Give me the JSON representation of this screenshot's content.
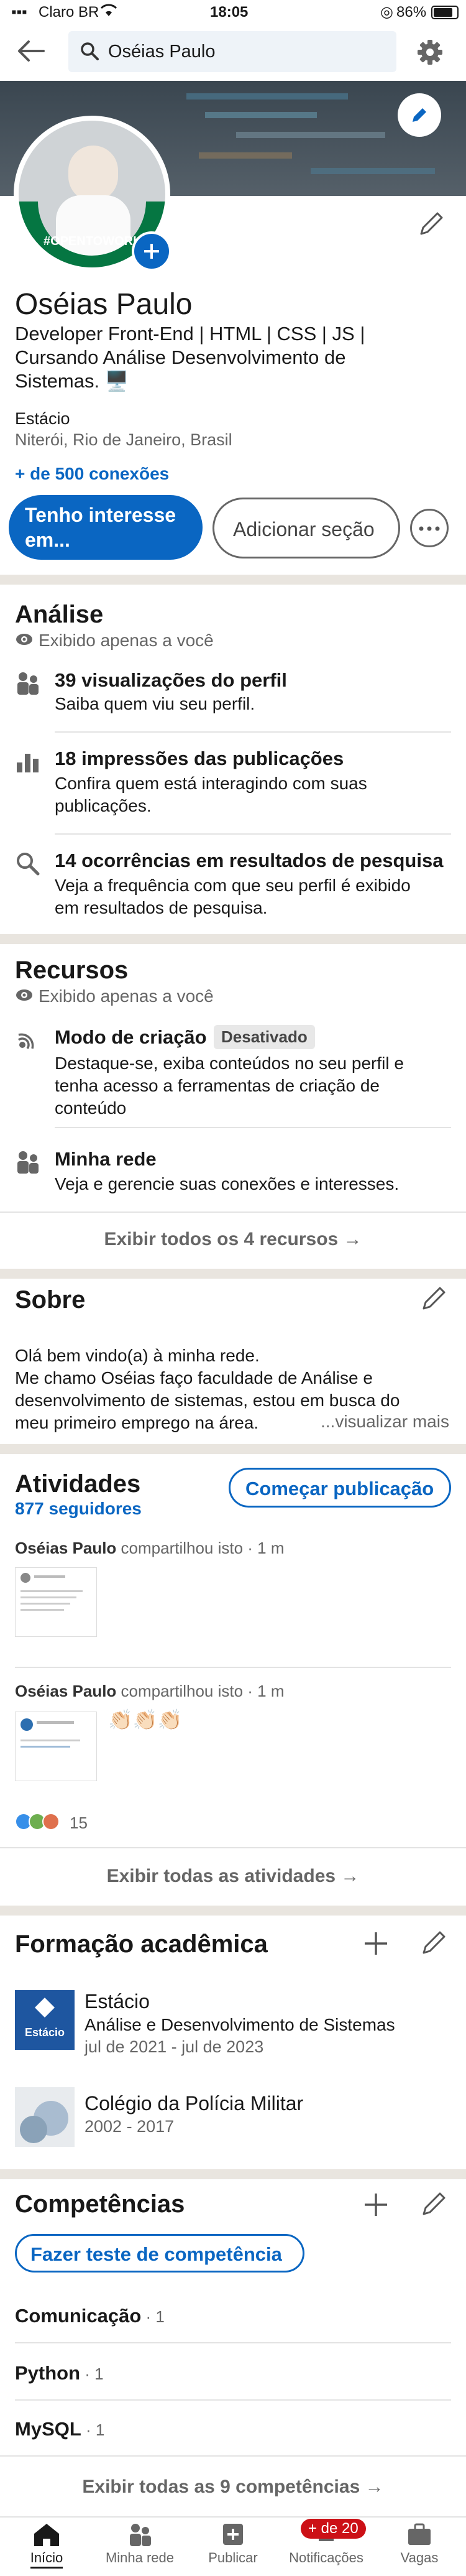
{
  "status": {
    "carrier": "Claro BR",
    "time": "18:05",
    "battery": "86%"
  },
  "search": {
    "query": "Oséias Paulo"
  },
  "profile": {
    "open_to_work": "#OPENTOWORK",
    "name": "Oséias Paulo",
    "headline_1": "Developer Front-End | HTML | CSS | JS |",
    "headline_2": "Cursando Análise Desenvolvimento de",
    "headline_3": "Sistemas. 🖥️",
    "institution": "Estácio",
    "location": "Niterói, Rio de Janeiro, Brasil",
    "connections": "+ de 500 conexões",
    "btn_interest_1": "Tenho interesse",
    "btn_interest_2": "em...",
    "btn_add_section": "Adicionar seção"
  },
  "analysis": {
    "title": "Análise",
    "private": "Exibido apenas a você",
    "items": [
      {
        "title": "39 visualizações do perfil",
        "desc_1": "Saiba quem viu seu perfil.",
        "desc_2": ""
      },
      {
        "title": "18 impressões das publicações",
        "desc_1": "Confira quem está interagindo com suas",
        "desc_2": "publicações."
      },
      {
        "title": "14 ocorrências em resultados de pesquisa",
        "desc_1": "Veja a frequência com que seu perfil é exibido",
        "desc_2": "em resultados de pesquisa."
      }
    ]
  },
  "resources": {
    "title": "Recursos",
    "private": "Exibido apenas a você",
    "creator_title": "Modo de criação",
    "creator_badge": "Desativado",
    "creator_desc_1": "Destaque-se, exiba conteúdos no seu perfil e",
    "creator_desc_2": "tenha acesso a ferramentas de criação de",
    "creator_desc_3": "conteúdo",
    "network_title": "Minha rede",
    "network_desc": "Veja e gerencie suas conexões e interesses.",
    "show_all": "Exibir todos os 4 recursos →"
  },
  "about": {
    "title": "Sobre",
    "line_1": "Olá bem vindo(a) à minha rede.",
    "line_2": "Me chamo Oséias faço faculdade de Análise e",
    "line_3": "desenvolvimento de sistemas, estou em busca do",
    "line_4": "meu primeiro emprego na área.",
    "more": "...visualizar mais"
  },
  "activity": {
    "title": "Atividades",
    "followers": "877 seguidores",
    "start_post": "Começar publicação",
    "post1_author": "Oséias Paulo",
    "post1_meta": " compartilhou isto · 1 m",
    "post2_author": "Oséias Paulo",
    "post2_meta": " compartilhou isto · 1 m",
    "post2_emoji": "👏🏻👏🏻👏🏻",
    "reactions": "15",
    "show_all": "Exibir todas as atividades →"
  },
  "education": {
    "title": "Formação acadêmica",
    "items": [
      {
        "logo": "Estácio",
        "school": "Estácio",
        "degree": "Análise e Desenvolvimento de Sistemas",
        "dates": "jul de 2021 - jul de 2023"
      },
      {
        "school": "Colégio da Polícia Militar",
        "dates": "2002 - 2017"
      }
    ]
  },
  "skills": {
    "title": "Competências",
    "test_button": "Fazer teste de competência",
    "items": [
      {
        "name": "Comunicação",
        "count": " · 1"
      },
      {
        "name": "Python",
        "count": " · 1"
      },
      {
        "name": "MySQL",
        "count": " · 1"
      }
    ],
    "show_all": "Exibir todas as 9 competências →"
  },
  "nav": {
    "home": "Início",
    "network": "Minha rede",
    "post": "Publicar",
    "notifications": "Notificações",
    "notif_badge": "+ de 20",
    "jobs": "Vagas"
  },
  "colors": {
    "primary": "#0a66c2",
    "badge": "#cc1016",
    "opentowork": "#057642"
  }
}
